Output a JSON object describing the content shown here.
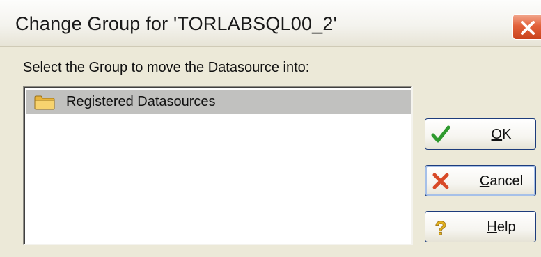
{
  "dialog": {
    "title": "Change Group for 'TORLABSQL00_2'",
    "instruction": "Select the Group to move the Datasource into:"
  },
  "list": {
    "items": [
      {
        "label": "Registered Datasources",
        "icon": "folder-icon",
        "selected": true
      }
    ]
  },
  "buttons": {
    "ok": {
      "mnemonic": "O",
      "rest": "K",
      "icon": "checkmark-icon"
    },
    "cancel": {
      "mnemonic": "C",
      "rest": "ancel",
      "icon": "cross-icon"
    },
    "help": {
      "mnemonic": "H",
      "rest": "elp",
      "icon": "question-icon"
    }
  },
  "colors": {
    "close_button": "#e3623b",
    "selection_background": "#c1c1bf",
    "folder": "#f0c24a",
    "ok_icon": "#2e9a2e",
    "cancel_icon": "#d84a28",
    "help_icon": "#e4b320"
  }
}
